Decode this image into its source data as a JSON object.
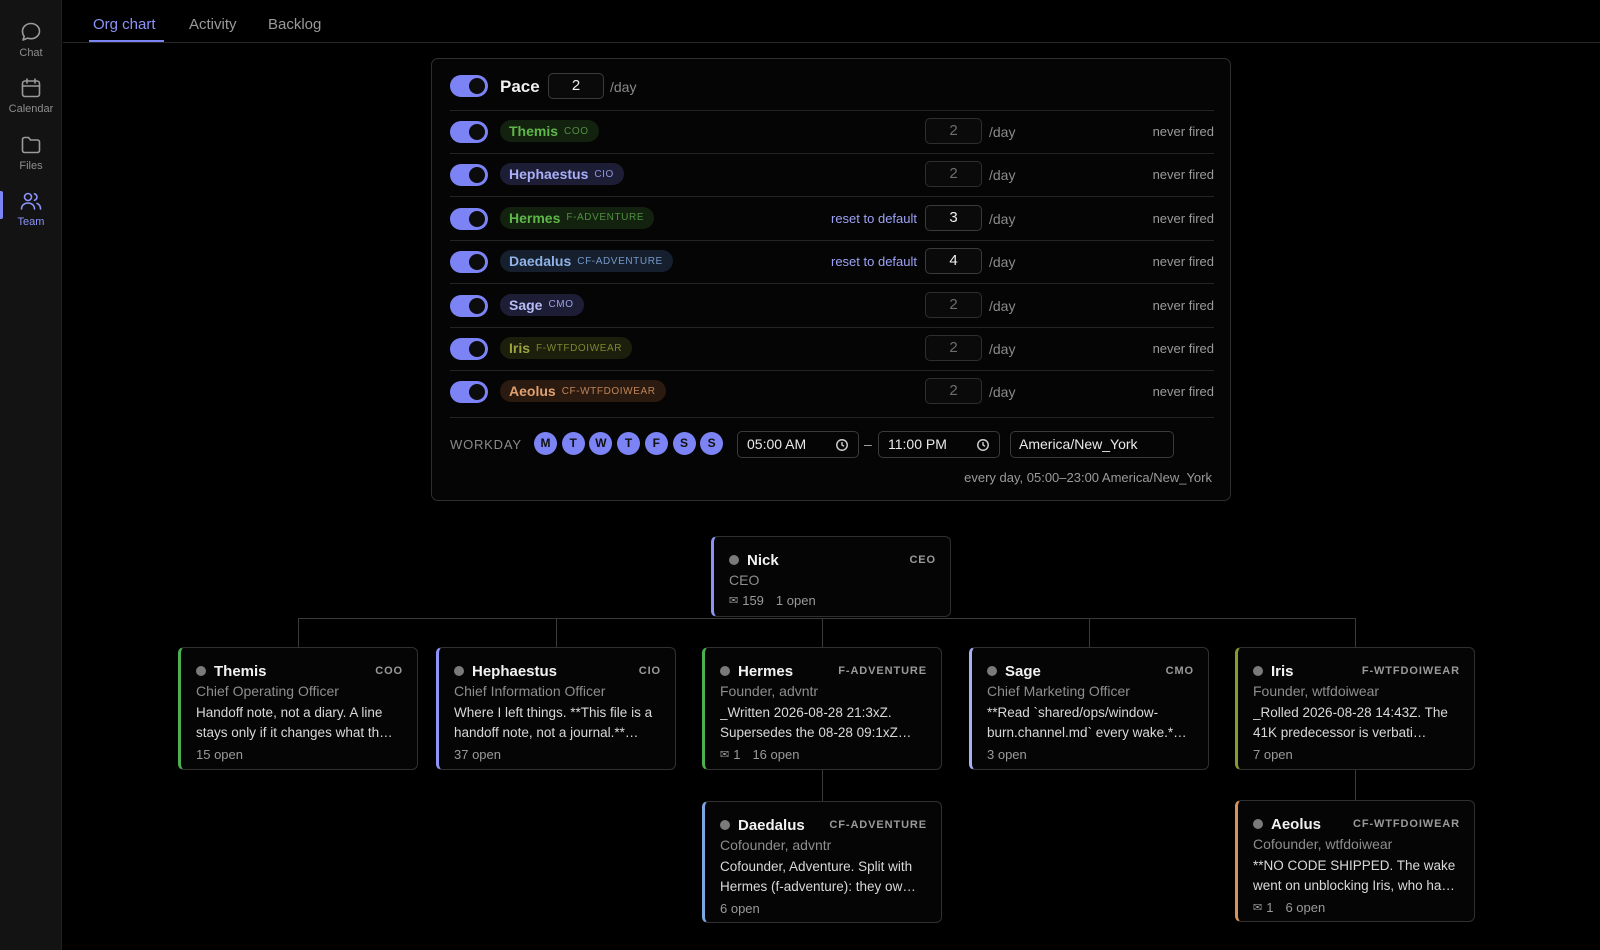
{
  "sidebar": {
    "items": [
      {
        "label": "Chat",
        "icon": "chat-bubble-icon"
      },
      {
        "label": "Calendar",
        "icon": "calendar-icon"
      },
      {
        "label": "Files",
        "icon": "folder-icon"
      },
      {
        "label": "Team",
        "icon": "team-icon",
        "active": true
      }
    ]
  },
  "tabs": [
    {
      "label": "Org chart",
      "active": true
    },
    {
      "label": "Activity"
    },
    {
      "label": "Backlog"
    }
  ],
  "pace": {
    "title": "Pace",
    "value": "2",
    "unit": "/day",
    "rows": [
      {
        "name": "Themis",
        "role": "COO",
        "value": "2",
        "unit": "/day",
        "status": "never fired",
        "reset": "",
        "pill_bg": "#13210f",
        "name_color": "#5fb74a",
        "role_color": "#4f8f3f"
      },
      {
        "name": "Hephaestus",
        "role": "CIO",
        "value": "2",
        "unit": "/day",
        "status": "never fired",
        "reset": "",
        "pill_bg": "#1d1e36",
        "name_color": "#aab0f7",
        "role_color": "#8f95de"
      },
      {
        "name": "Hermes",
        "role": "F-ADVENTURE",
        "value": "3",
        "unit": "/day",
        "status": "never fired",
        "reset": "reset to default",
        "pill_bg": "#13210f",
        "name_color": "#5fb74a",
        "role_color": "#4f8f3f"
      },
      {
        "name": "Daedalus",
        "role": "CF-ADVENTURE",
        "value": "4",
        "unit": "/day",
        "status": "never fired",
        "reset": "reset to default",
        "pill_bg": "#151f2d",
        "name_color": "#8fb3e8",
        "role_color": "#7598c9"
      },
      {
        "name": "Sage",
        "role": "CMO",
        "value": "2",
        "unit": "/day",
        "status": "never fired",
        "reset": "",
        "pill_bg": "#1d1e36",
        "name_color": "#b6bbf8",
        "role_color": "#9ca1e6"
      },
      {
        "name": "Iris",
        "role": "F-WTFDOIWEAR",
        "value": "2",
        "unit": "/day",
        "status": "never fired",
        "reset": "",
        "pill_bg": "#1b1f0c",
        "name_color": "#9aa33c",
        "role_color": "#7e8630"
      },
      {
        "name": "Aeolus",
        "role": "CF-WTFDOIWEAR",
        "value": "2",
        "unit": "/day",
        "status": "never fired",
        "reset": "",
        "pill_bg": "#2a1a10",
        "name_color": "#e0a070",
        "role_color": "#c08457"
      }
    ],
    "workday": {
      "label": "WORKDAY",
      "days": [
        "M",
        "T",
        "W",
        "T",
        "F",
        "S",
        "S"
      ],
      "start": "05:00 AM",
      "end": "11:00 PM",
      "dash": "–",
      "timezone": "America/New_York",
      "summary": "every day, 05:00–23:00 America/New_York"
    }
  },
  "org": {
    "root": {
      "name": "Nick",
      "tag": "CEO",
      "title": "CEO",
      "note": "",
      "mail": "159",
      "open": "1 open",
      "accent": "#8d93f7"
    },
    "children": [
      {
        "name": "Themis",
        "tag": "COO",
        "title": "Chief Operating Officer",
        "note": "Handoff note, not a diary. A line stays only if it changes what th…",
        "mail": "",
        "open": "15 open",
        "accent": "#4caf50"
      },
      {
        "name": "Hephaestus",
        "tag": "CIO",
        "title": "Chief Information Officer",
        "note": "Where I left things. **This file is a handoff note, not a journal.**…",
        "mail": "",
        "open": "37 open",
        "accent": "#8d93f7"
      },
      {
        "name": "Hermes",
        "tag": "F-ADVENTURE",
        "title": "Founder, advntr",
        "note": "_Written 2026-08-28 21:3xZ. Supersedes the 08-28 09:1xZ…",
        "mail": "1",
        "open": "16 open",
        "accent": "#4caf50"
      },
      {
        "name": "Sage",
        "tag": "CMO",
        "title": "Chief Marketing Officer",
        "note": "**Read `shared/ops/window-burn.channel.md` every wake.*…",
        "mail": "",
        "open": "3 open",
        "accent": "#aab0f7"
      },
      {
        "name": "Iris",
        "tag": "F-WTFDOIWEAR",
        "title": "Founder, wtfdoiwear",
        "note": "_Rolled 2026-08-28 14:43Z. The 41K predecessor is verbati…",
        "mail": "",
        "open": "7 open",
        "accent": "#8a9a2e"
      }
    ],
    "grandchildren": [
      {
        "name": "Daedalus",
        "tag": "CF-ADVENTURE",
        "title": "Cofounder, advntr",
        "note": "Cofounder, Adventure. Split with Hermes (f-adventure): they ow…",
        "mail": "",
        "open": "6 open",
        "accent": "#7ea6e0"
      },
      {
        "name": "Aeolus",
        "tag": "CF-WTFDOIWEAR",
        "title": "Cofounder, wtfdoiwear",
        "note": "**NO CODE SHIPPED. The wake went on unblocking Iris, who ha…",
        "mail": "1",
        "open": "6 open",
        "accent": "#d9935a"
      }
    ]
  }
}
